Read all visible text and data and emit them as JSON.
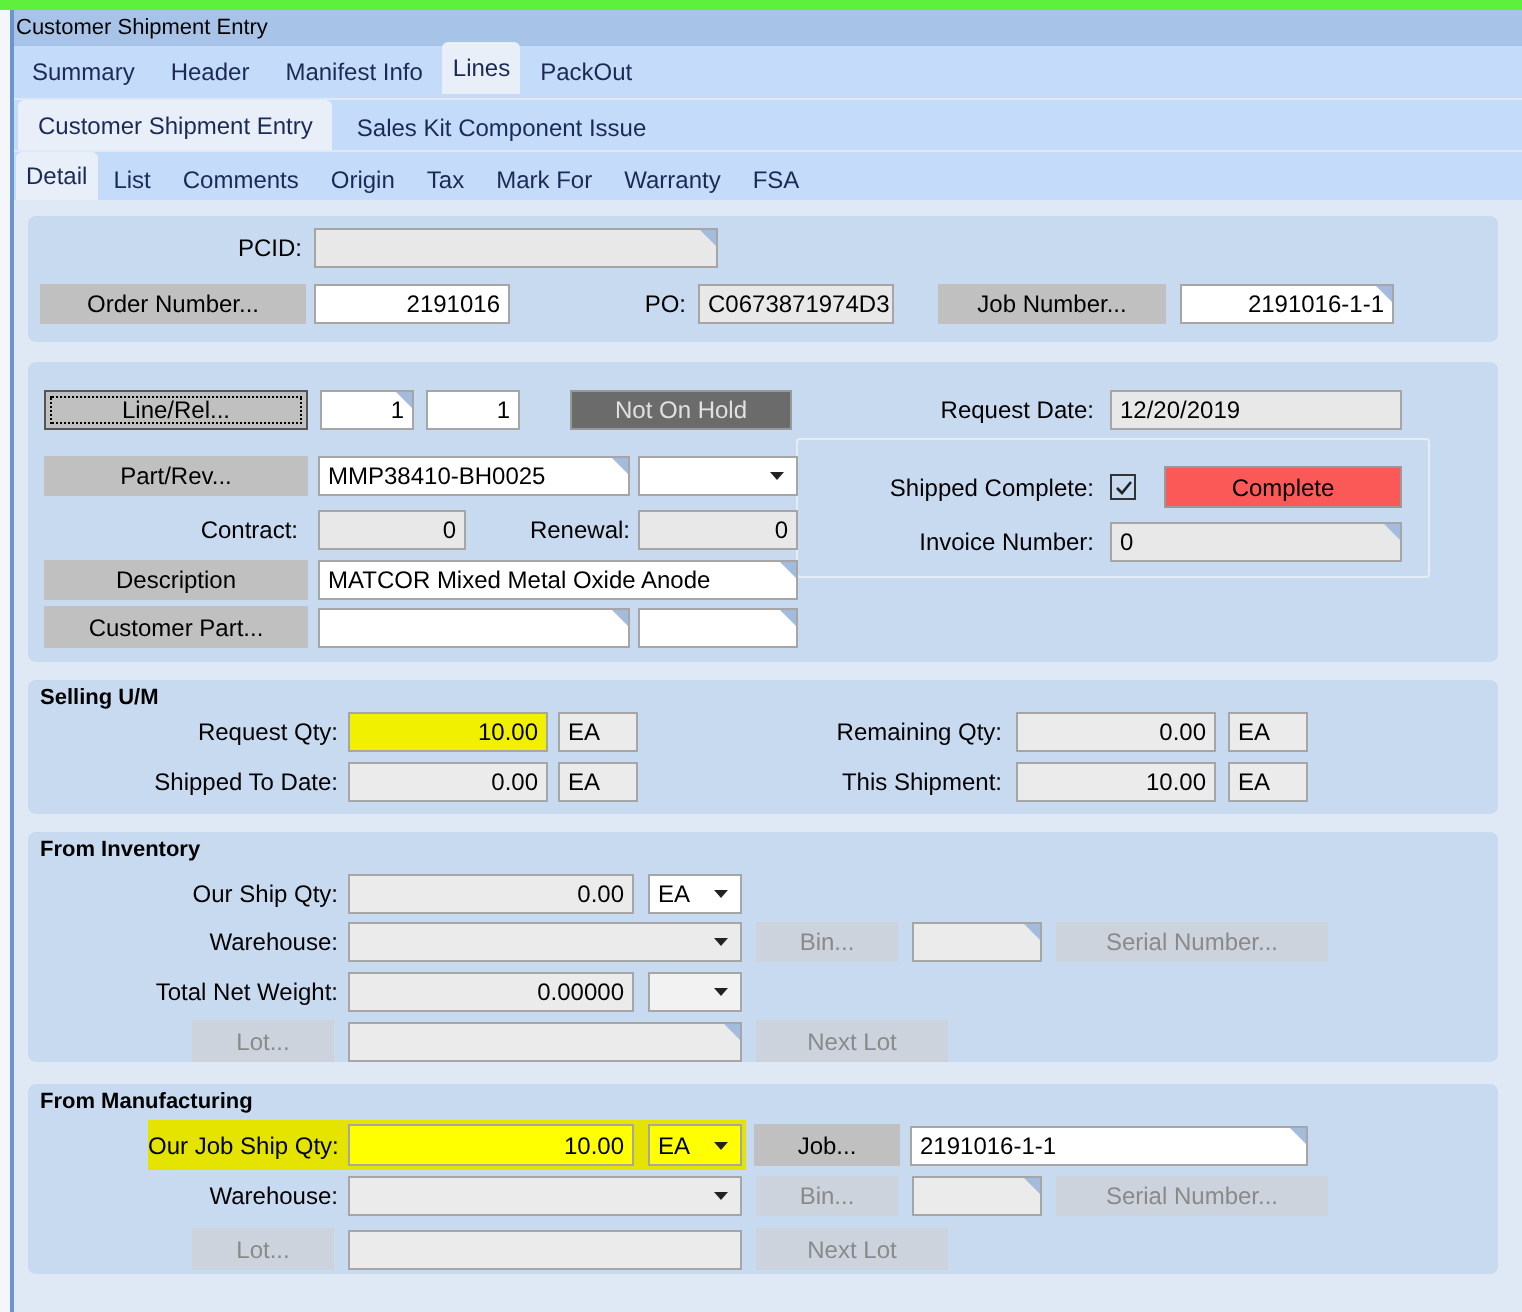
{
  "window": {
    "title": "Customer Shipment Entry"
  },
  "tabs": [
    {
      "label": "Summary",
      "selected": false
    },
    {
      "label": "Header",
      "selected": false
    },
    {
      "label": "Manifest Info",
      "selected": false
    },
    {
      "label": "Lines",
      "selected": true
    },
    {
      "label": "PackOut",
      "selected": false
    }
  ],
  "subtabs": [
    {
      "label": "Customer Shipment Entry",
      "selected": true
    },
    {
      "label": "Sales Kit Component Issue",
      "selected": false
    }
  ],
  "detail_tabs": [
    {
      "label": "Detail",
      "selected": true
    },
    {
      "label": "List",
      "selected": false
    },
    {
      "label": "Comments",
      "selected": false
    },
    {
      "label": "Origin",
      "selected": false
    },
    {
      "label": "Tax",
      "selected": false
    },
    {
      "label": "Mark For",
      "selected": false
    },
    {
      "label": "Warranty",
      "selected": false
    },
    {
      "label": "FSA",
      "selected": false
    }
  ],
  "header_panel": {
    "pcid_label": "PCID:",
    "order_button": "Order Number...",
    "order_number": "2191016",
    "po_label": "PO:",
    "po": "C0673871974D3",
    "job_button": "Job Number...",
    "job_number": "2191016-1-1"
  },
  "line_panel": {
    "line_button": "Line/Rel...",
    "line": "1",
    "release": "1",
    "hold_status": "Not On Hold",
    "request_date_label": "Request Date:",
    "request_date": "12/20/2019",
    "part_button": "Part/Rev...",
    "part": "MMP38410-BH0025",
    "contract_label": "Contract:",
    "contract": "0",
    "renewal_label": "Renewal:",
    "renewal": "0",
    "description_button": "Description",
    "description": "MATCOR Mixed Metal Oxide Anode",
    "customer_part_button": "Customer Part...",
    "shipped_complete": {
      "label": "Shipped Complete:",
      "checked": true
    },
    "complete_status": "Complete",
    "invoice_label": "Invoice Number:",
    "invoice": "0"
  },
  "selling_um": {
    "title": "Selling U/M",
    "fields": [
      {
        "label": "Request Qty:",
        "value": "10.00",
        "uom": "EA",
        "highlighted": true
      },
      {
        "label": "Remaining Qty:",
        "value": "0.00",
        "uom": "EA",
        "highlighted": false
      },
      {
        "label": "Shipped To Date:",
        "value": "0.00",
        "uom": "EA",
        "highlighted": false
      },
      {
        "label": "This Shipment:",
        "value": "10.00",
        "uom": "EA",
        "highlighted": false
      }
    ]
  },
  "from_inventory": {
    "title": "From Inventory",
    "ship_qty": {
      "label": "Our Ship Qty:",
      "value": "0.00",
      "uom": "EA",
      "highlighted": false
    },
    "warehouse_label": "Warehouse:",
    "bin_button": {
      "label": "Bin...",
      "disabled": true
    },
    "serial_button": {
      "label": "Serial Number...",
      "disabled": true
    },
    "weight_label": "Total Net Weight:",
    "weight": "0.00000",
    "lot_button": {
      "label": "Lot...",
      "disabled": true
    },
    "next_lot_button": {
      "label": "Next Lot",
      "disabled": true
    }
  },
  "from_manufacturing": {
    "title": "From Manufacturing",
    "ship_qty": {
      "label": "Our Job Ship Qty:",
      "value": "10.00",
      "uom": "EA",
      "highlighted": true
    },
    "job_button": {
      "label": "Job...",
      "disabled": false
    },
    "job": "2191016-1-1",
    "warehouse_label": "Warehouse:",
    "bin_button": {
      "label": "Bin...",
      "disabled": true
    },
    "serial_button": {
      "label": "Serial Number...",
      "disabled": true
    },
    "lot_button": {
      "label": "Lot...",
      "disabled": true
    },
    "next_lot_button": {
      "label": "Next Lot",
      "disabled": true
    }
  }
}
